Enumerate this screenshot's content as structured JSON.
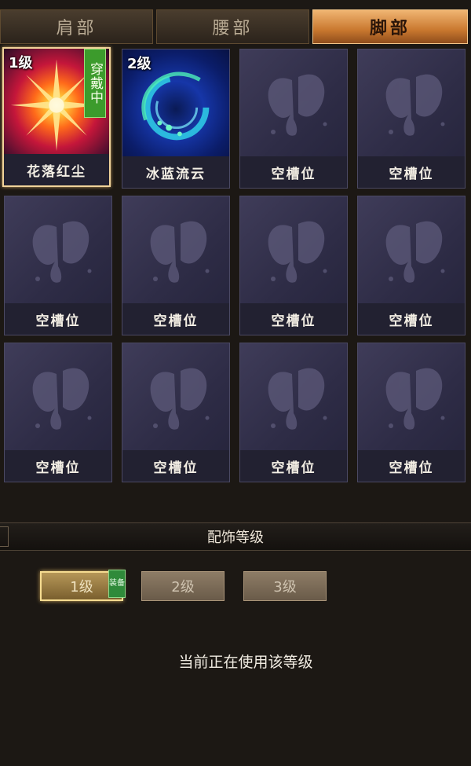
{
  "tabs": [
    {
      "label": "肩部",
      "active": false
    },
    {
      "label": "腰部",
      "active": false
    },
    {
      "label": "脚部",
      "active": true
    }
  ],
  "slots": [
    {
      "name": "花落红尘",
      "level": "1级",
      "badge": "穿戴中",
      "icon": "red-burst-icon"
    },
    {
      "name": "冰蓝流云",
      "level": "2级",
      "icon": "blue-swirl-icon"
    },
    {
      "name": "空槽位",
      "icon": "butterfly-icon"
    },
    {
      "name": "空槽位",
      "icon": "butterfly-icon"
    },
    {
      "name": "空槽位",
      "icon": "butterfly-icon"
    },
    {
      "name": "空槽位",
      "icon": "butterfly-icon"
    },
    {
      "name": "空槽位",
      "icon": "butterfly-icon"
    },
    {
      "name": "空槽位",
      "icon": "butterfly-icon"
    },
    {
      "name": "空槽位",
      "icon": "butterfly-icon"
    },
    {
      "name": "空槽位",
      "icon": "butterfly-icon"
    },
    {
      "name": "空槽位",
      "icon": "butterfly-icon"
    },
    {
      "name": "空槽位",
      "icon": "butterfly-icon"
    }
  ],
  "accessory_level": {
    "title": "配饰等级",
    "buttons": [
      {
        "label": "1级",
        "active": true
      },
      {
        "label": "2级",
        "active": false
      },
      {
        "label": "3级",
        "active": false
      }
    ],
    "equip_badge": "装备",
    "status": "当前正在使用该等级"
  },
  "colors": {
    "active_tab": "#e09a52",
    "wearing_badge": "#3c9b2c",
    "slot_bg": "#35334f",
    "panel_bg": "#1c1814"
  }
}
